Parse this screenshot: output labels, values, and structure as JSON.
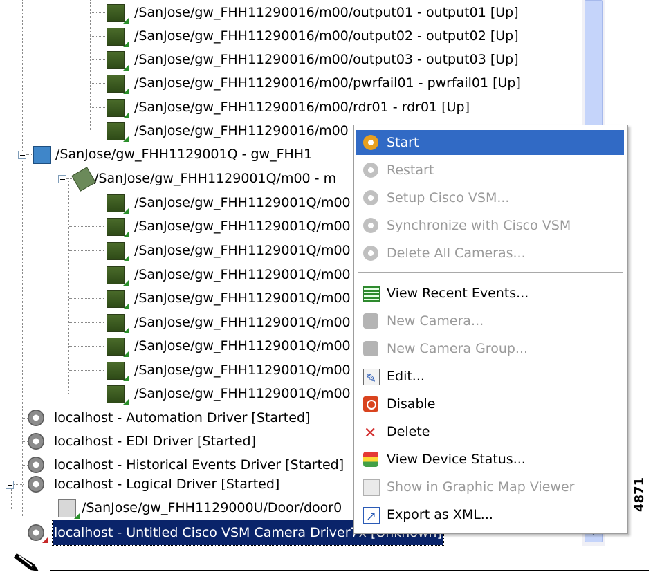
{
  "tree": {
    "outputs": [
      "/SanJose/gw_FHH11290016/m00/output01 - output01 [Up]",
      "/SanJose/gw_FHH11290016/m00/output02 - output02 [Up]",
      "/SanJose/gw_FHH11290016/m00/output03 - output03 [Up]",
      "/SanJose/gw_FHH11290016/m00/pwrfail01 - pwrfail01 [Up]",
      "/SanJose/gw_FHH11290016/m00/rdr01 - rdr01 [Up]",
      "/SanJose/gw_FHH11290016/m00"
    ],
    "gateway2": "/SanJose/gw_FHH1129001Q - gw_FHH1",
    "module2": "/SanJose/gw_FHH1129001Q/m00 - m",
    "module2_children": [
      "/SanJose/gw_FHH1129001Q/m00",
      "/SanJose/gw_FHH1129001Q/m00",
      "/SanJose/gw_FHH1129001Q/m00",
      "/SanJose/gw_FHH1129001Q/m00",
      "/SanJose/gw_FHH1129001Q/m00",
      "/SanJose/gw_FHH1129001Q/m00",
      "/SanJose/gw_FHH1129001Q/m00",
      "/SanJose/gw_FHH1129001Q/m00",
      "/SanJose/gw_FHH1129001Q/m00"
    ],
    "drivers": [
      "localhost - Automation Driver [Started]",
      "localhost - EDI Driver [Started]",
      "localhost - Historical Events Driver [Started]",
      "localhost - Logical Driver [Started]"
    ],
    "door": "/SanJose/gw_FHH1129000U/Door/door0",
    "selected": "localhost - Untitled Cisco VSM Camera Driver7x [Unknown]"
  },
  "menu": {
    "items": [
      {
        "label": "Start",
        "icon": "start-gear-icon",
        "state": "highlighted"
      },
      {
        "label": "Restart",
        "icon": "restart-gear-icon",
        "state": "disabled"
      },
      {
        "label": "Setup Cisco VSM...",
        "icon": "setup-gear-icon",
        "state": "disabled"
      },
      {
        "label": "Synchronize with Cisco VSM",
        "icon": "sync-gear-icon",
        "state": "disabled"
      },
      {
        "label": "Delete All Cameras...",
        "icon": "delete-cameras-gear-icon",
        "state": "disabled"
      },
      {
        "label": "View Recent Events...",
        "icon": "events-list-icon",
        "state": "enabled"
      },
      {
        "label": "New Camera...",
        "icon": "camera-icon",
        "state": "disabled"
      },
      {
        "label": "New Camera Group...",
        "icon": "camera-group-icon",
        "state": "disabled"
      },
      {
        "label": "Edit...",
        "icon": "edit-icon",
        "state": "enabled"
      },
      {
        "label": "Disable",
        "icon": "disable-icon",
        "state": "enabled"
      },
      {
        "label": "Delete",
        "icon": "delete-x-icon",
        "state": "enabled"
      },
      {
        "label": "View Device Status...",
        "icon": "traffic-light-icon",
        "state": "enabled"
      },
      {
        "label": "Show in Graphic Map Viewer",
        "icon": "map-viewer-icon",
        "state": "disabled"
      },
      {
        "label": "Export as XML...",
        "icon": "export-icon",
        "state": "enabled"
      }
    ]
  },
  "figure_id": "4871",
  "colors": {
    "highlight": "#316ac5",
    "selection": "#0a246a",
    "scroll_thumb": "#c5d4fa"
  }
}
